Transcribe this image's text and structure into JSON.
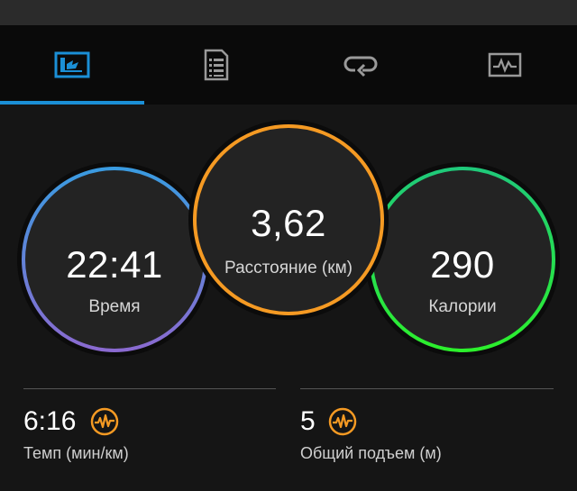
{
  "tabs": [
    {
      "icon": "dashboard-icon",
      "active": true
    },
    {
      "icon": "details-list-icon",
      "active": false
    },
    {
      "icon": "laps-loop-icon",
      "active": false
    },
    {
      "icon": "chart-graph-icon",
      "active": false
    }
  ],
  "metrics": {
    "time": {
      "value": "22:41",
      "label": "Время",
      "color": "#5a7fd6"
    },
    "distance": {
      "value": "3,62",
      "label": "Расстояние (км)",
      "color": "#f59a23"
    },
    "calories": {
      "value": "290",
      "label": "Калории",
      "color": "#22d64a"
    }
  },
  "stats": {
    "pace": {
      "value": "6:16",
      "label": "Темп (мин/км)",
      "icon": "performance-wave-icon"
    },
    "ascent": {
      "value": "5",
      "label": "Общий подъем (м)",
      "icon": "performance-wave-icon"
    }
  },
  "colors": {
    "accent_blue": "#1b8fd6",
    "icon_orange": "#f59a23"
  }
}
